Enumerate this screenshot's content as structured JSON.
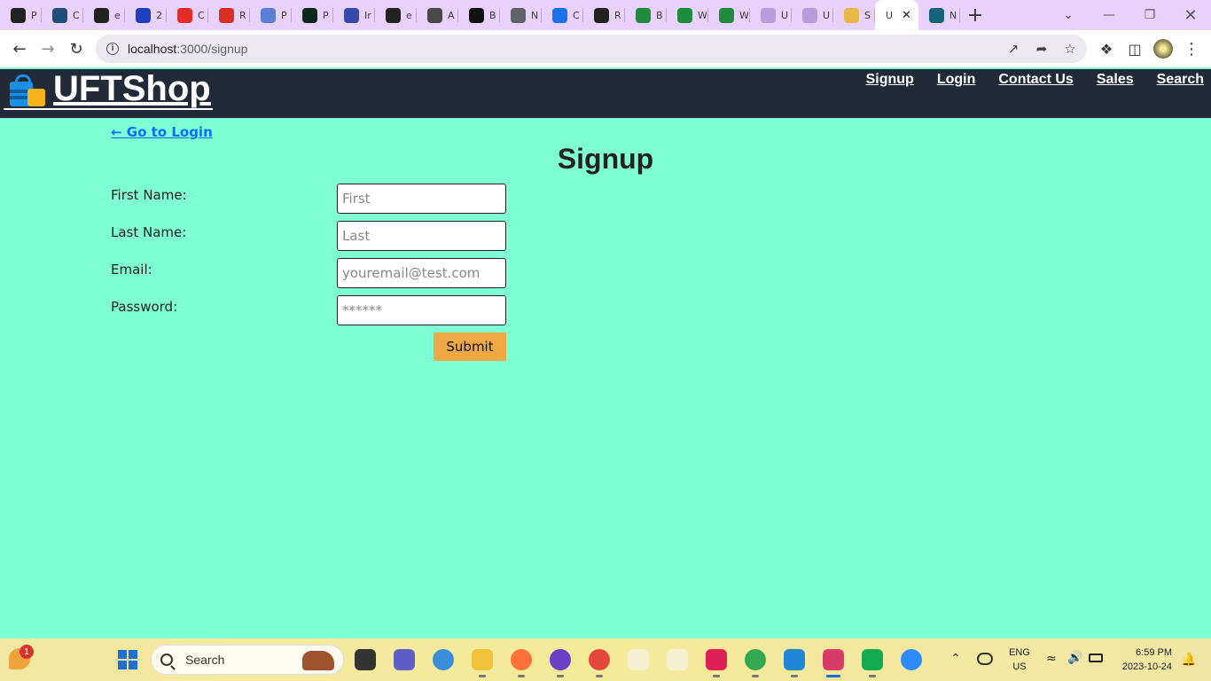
{
  "browser": {
    "tabs": [
      {
        "icon": "github-icon",
        "title": "P",
        "color": "#222222"
      },
      {
        "icon": "tree-icon",
        "title": "C",
        "color": "#1f4e79"
      },
      {
        "icon": "github-icon",
        "title": "e",
        "color": "#222222"
      },
      {
        "icon": "exclaim-icon",
        "title": "2",
        "color": "#1f3fbf"
      },
      {
        "icon": "youtube-icon",
        "title": "C",
        "color": "#e52d27"
      },
      {
        "icon": "gmail-icon",
        "title": "R",
        "color": "#d93025"
      },
      {
        "icon": "zeta-icon",
        "title": "P",
        "color": "#5b7fd6"
      },
      {
        "icon": "leaf-icon",
        "title": "P",
        "color": "#0b2a1a"
      },
      {
        "icon": "ring-icon",
        "title": "Ir",
        "color": "#3949ab"
      },
      {
        "icon": "github-icon",
        "title": "e",
        "color": "#222222"
      },
      {
        "icon": "grid-icon",
        "title": "A",
        "color": "#4a4a4a"
      },
      {
        "icon": "bowtie-icon",
        "title": "B",
        "color": "#111111"
      },
      {
        "icon": "chrome-icon",
        "title": "N",
        "color": "#5f6368"
      },
      {
        "icon": "circle-c-icon",
        "title": "C",
        "color": "#1a73e8"
      },
      {
        "icon": "github-icon",
        "title": "R",
        "color": "#222222"
      },
      {
        "icon": "w-icon",
        "title": "B",
        "color": "#1e8c3a"
      },
      {
        "icon": "w-icon",
        "title": "W",
        "color": "#1e8c3a"
      },
      {
        "icon": "w-icon",
        "title": "W",
        "color": "#1e8c3a"
      },
      {
        "icon": "shield-v-icon",
        "title": "U",
        "color": "#b39ddb"
      },
      {
        "icon": "shield-v-icon",
        "title": "U",
        "color": "#b39ddb"
      },
      {
        "icon": "ball-icon",
        "title": "S",
        "color": "#e6b84a"
      }
    ],
    "active_tab": {
      "title": "U",
      "close": "✕"
    },
    "extra_tab": {
      "icon": "xb-icon",
      "title": "N",
      "color": "#17637a"
    },
    "new_tab_symbol": "+",
    "address_bar": {
      "host": "localhost",
      "path": ":3000/signup"
    }
  },
  "header": {
    "brand": "UFTShop",
    "nav": [
      "Signup",
      "Login",
      "Contact Us",
      "Sales",
      "Search"
    ]
  },
  "page": {
    "back_link": "← Go to Login",
    "title": "Signup",
    "fields": [
      {
        "label": "First Name:",
        "placeholder": "First"
      },
      {
        "label": "Last Name:",
        "placeholder": "Last"
      },
      {
        "label": "Email:",
        "placeholder": "youremail@test.com"
      },
      {
        "label": "Password:",
        "placeholder": "******"
      }
    ],
    "submit_label": "Submit"
  },
  "taskbar": {
    "search_label": "Search",
    "notification_count": "1",
    "language": {
      "line1": "ENG",
      "line2": "US"
    },
    "clock": {
      "time": "6:59 PM",
      "date": "2023-10-24"
    },
    "apps": [
      {
        "name": "start-icon",
        "color": "#1f6fd1"
      },
      {
        "name": "task-view-icon",
        "color": "#333333"
      },
      {
        "name": "meet-icon",
        "color": "#5b5fc7"
      },
      {
        "name": "people-icon",
        "color": "#3a8fd6"
      },
      {
        "name": "file-explorer-icon",
        "color": "#f0c23a"
      },
      {
        "name": "firefox-icon",
        "color": "#ff7139"
      },
      {
        "name": "github-desktop-icon",
        "color": "#6e40c9"
      },
      {
        "name": "chrome-icon",
        "color": "#e3463a"
      },
      {
        "name": "blank-app-icon",
        "color": "#f5f0d2"
      },
      {
        "name": "blank-app-icon",
        "color": "#f5f0d2"
      },
      {
        "name": "slack-icon",
        "color": "#e01e5a"
      },
      {
        "name": "chrome-profile-icon",
        "color": "#34a853"
      },
      {
        "name": "vscode-icon",
        "color": "#1f86d8"
      },
      {
        "name": "snipping-tool-icon",
        "color": "#d83b6a"
      },
      {
        "name": "mongodb-icon",
        "color": "#13aa52"
      },
      {
        "name": "zoom-icon",
        "color": "#2d8cff"
      }
    ]
  }
}
